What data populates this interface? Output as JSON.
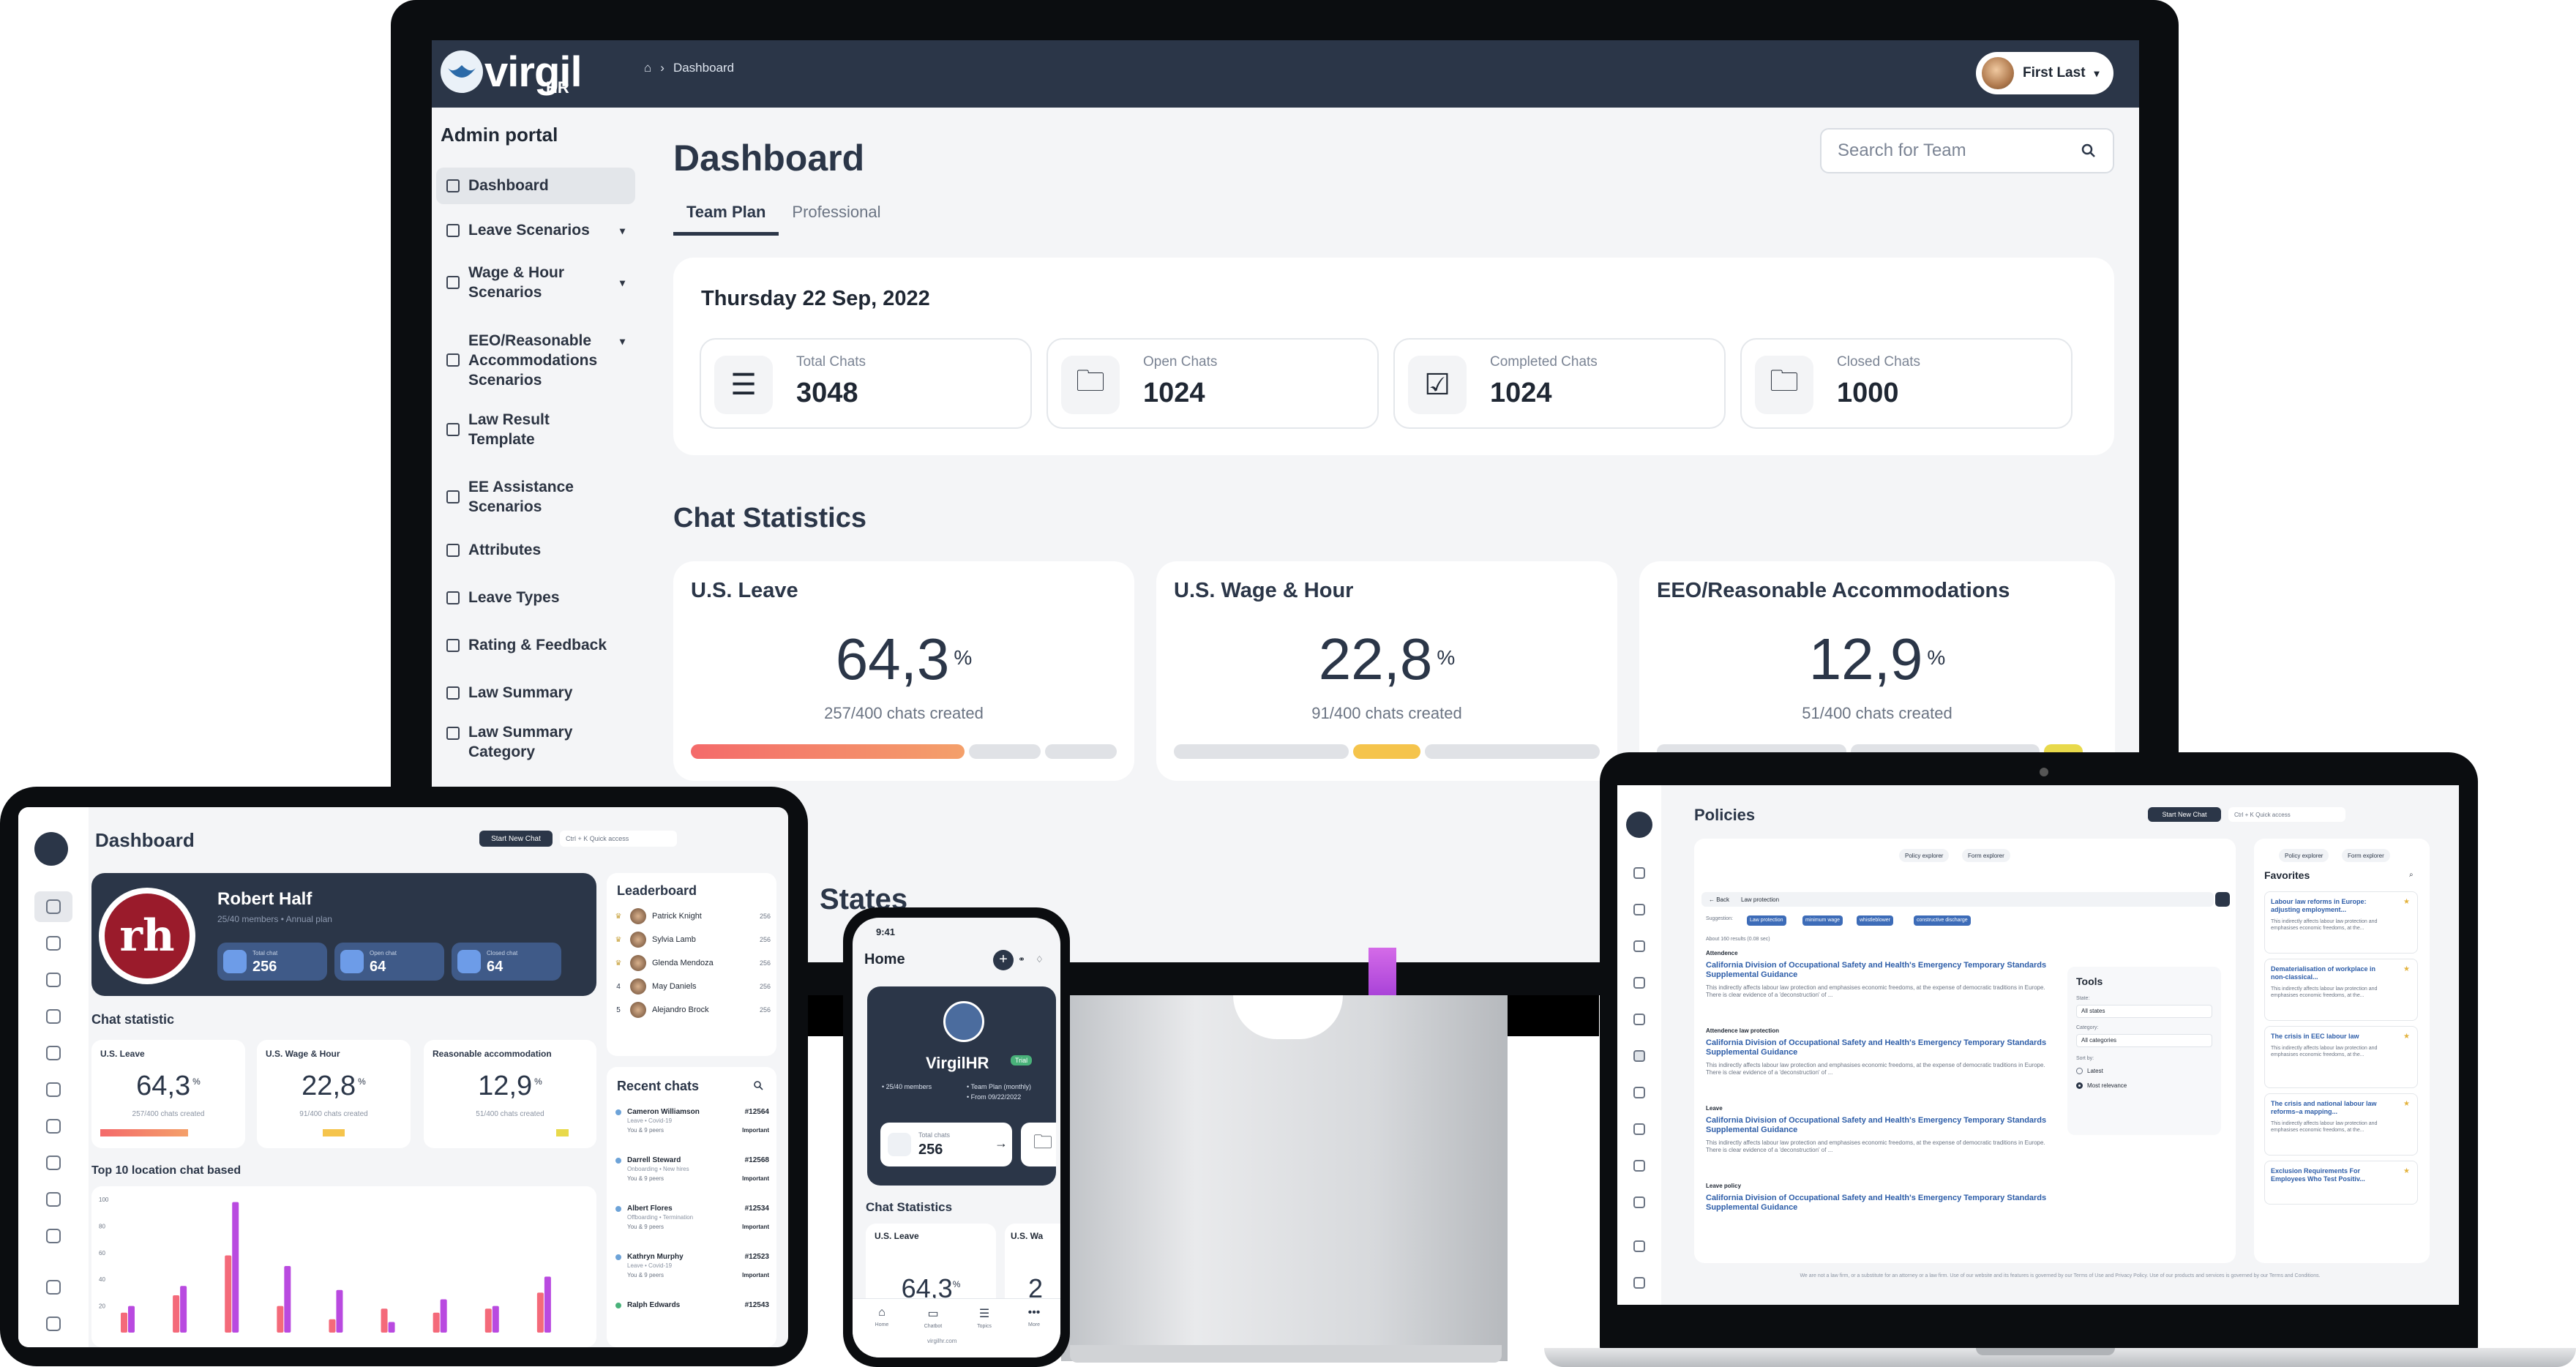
{
  "monitor": {
    "brand": "virgil",
    "brand_sub": "HR",
    "breadcrumb": "Dashboard",
    "user_name": "First Last",
    "sidebar_title": "Admin portal",
    "sidebar": [
      {
        "label": "Dashboard",
        "icon": "home-icon"
      },
      {
        "label": "Leave Scenarios",
        "icon": "document-icon",
        "chevron": "▾"
      },
      {
        "label": "Wage & Hour Scenarios",
        "icon": "document-icon",
        "chevron": "▾"
      },
      {
        "label": "EEO/Reasonable Accommodations Scenarios",
        "icon": "home-icon",
        "chevron": "▾"
      },
      {
        "label": "Law Result Template",
        "icon": "book-icon"
      },
      {
        "label": "EE Assistance Scenarios",
        "icon": "document-icon"
      },
      {
        "label": "Attributes",
        "icon": "list-icon"
      },
      {
        "label": "Leave Types",
        "icon": "card-icon"
      },
      {
        "label": "Rating & Feedback",
        "icon": "chat-icon"
      },
      {
        "label": "Law Summary",
        "icon": "folder-icon"
      },
      {
        "label": "Law Summary Category",
        "icon": "folder-icon"
      }
    ],
    "title": "Dashboard",
    "search_placeholder": "Search for Team",
    "tabs": [
      "Team Plan",
      "Professional"
    ],
    "date": "Thursday 22 Sep, 2022",
    "stats": [
      {
        "label": "Total Chats",
        "value": "3048",
        "icon": "checklist-icon"
      },
      {
        "label": "Open Chats",
        "value": "1024",
        "icon": "folder-open-icon"
      },
      {
        "label": "Completed Chats",
        "value": "1024",
        "icon": "checkbox-icon"
      },
      {
        "label": "Closed Chats",
        "value": "1000",
        "icon": "folder-icon"
      }
    ],
    "chat_stats_title": "Chat Statistics",
    "chat_cards": [
      {
        "title": "U.S. Leave",
        "value": "64,3",
        "unit": "%",
        "sub": "257/400 chats created",
        "level": 0.643,
        "color": "#f47a6a"
      },
      {
        "title": "U.S. Wage & Hour",
        "value": "22,8",
        "unit": "%",
        "sub": "91/400 chats created",
        "level": 0.228,
        "color": "#f5c44c"
      },
      {
        "title": "EEO/Reasonable Accommodations",
        "value": "12,9",
        "unit": "%",
        "sub": "51/400 chats created",
        "level": 0.129,
        "color": "#e8d94b"
      }
    ],
    "states_title": "States"
  },
  "tablet": {
    "title": "Dashboard",
    "new_chat": "Start New Chat",
    "quick": "Ctrl + K Quick access",
    "hero": {
      "logo_text": "rh",
      "name": "Robert Half",
      "sub": "25/40 members • Annual plan",
      "chips": [
        {
          "label": "Total chat",
          "value": "256"
        },
        {
          "label": "Open chat",
          "value": "64"
        },
        {
          "label": "Closed chat",
          "value": "64"
        }
      ]
    },
    "chat_statistic": "Chat statistic",
    "cards": [
      {
        "title": "U.S. Leave",
        "value": "64,3",
        "unit": "%",
        "sub": "257/400 chats created"
      },
      {
        "title": "U.S. Wage & Hour",
        "value": "22,8",
        "unit": "%",
        "sub": "91/400 chats created"
      },
      {
        "title": "Reasonable accommodation",
        "value": "12,9",
        "unit": "%",
        "sub": "51/400 chats created"
      }
    ],
    "top10_title": "Top 10 location chat based",
    "leaderboard_title": "Leaderboard",
    "leaderboard": [
      {
        "rank": "♛",
        "name": "Patrick Knight",
        "score": "256"
      },
      {
        "rank": "♛",
        "name": "Sylvia Lamb",
        "score": "256"
      },
      {
        "rank": "♛",
        "name": "Glenda Mendoza",
        "score": "256"
      },
      {
        "rank": "4",
        "name": "May Daniels",
        "score": "256"
      },
      {
        "rank": "5",
        "name": "Alejandro Brock",
        "score": "256"
      }
    ],
    "recent_title": "Recent chats",
    "recent": [
      {
        "name": "Cameron Williamson",
        "id": "#12564",
        "sub": "Leave • Covid-19",
        "meta": "You & 9 peers",
        "tag": "Important"
      },
      {
        "name": "Darrell Steward",
        "id": "#12568",
        "sub": "Onboarding • New hires",
        "meta": "You & 9 peers",
        "tag": "Important"
      },
      {
        "name": "Albert Flores",
        "id": "#12534",
        "sub": "Offboarding • Termination",
        "meta": "You & 9 peers",
        "tag": "Important"
      },
      {
        "name": "Kathryn Murphy",
        "id": "#12523",
        "sub": "Leave • Covid-19",
        "meta": "You & 9 peers",
        "tag": "Important"
      },
      {
        "name": "Ralph Edwards",
        "id": "#12543",
        "sub": "",
        "meta": "",
        "tag": ""
      }
    ]
  },
  "chart_data": {
    "type": "bar",
    "title": "Top 10 location chat based",
    "ylim": [
      0,
      100
    ],
    "yticks": [
      "100",
      "80",
      "60",
      "40",
      "20"
    ],
    "series": [
      {
        "color": "#f46a7a",
        "values": [
          15,
          28,
          58,
          20,
          10,
          18,
          15,
          18,
          30
        ]
      },
      {
        "color": "#b94ae0",
        "values": [
          20,
          35,
          98,
          50,
          32,
          8,
          25,
          20,
          42
        ]
      }
    ]
  },
  "phone": {
    "time": "9:41",
    "home": "Home",
    "hero_title": "VirgilHR",
    "trial": "Trial",
    "l1": "• 25/40 members",
    "l2": "• Team Plan (monthly)",
    "l3": "• From 09/22/2022",
    "total_label": "Total chats",
    "total_value": "256",
    "chat_stats": "Chat Statistics",
    "card1_title": "U.S. Leave",
    "card1_value": "64,3",
    "card1_unit": "%",
    "card2_title": "U.S. Wa",
    "card2_value": "2",
    "tabs": [
      "Home",
      "Chatbot",
      "Topics",
      "More"
    ],
    "url": "virgilhr.com"
  },
  "laptop": {
    "title": "Policies",
    "new_chat": "Start New Chat",
    "quick": "Ctrl + K Quick access",
    "pills": [
      "Policy explorer",
      "Form explorer"
    ],
    "back": "← Back",
    "query": "Law protection",
    "suggestion_label": "Suggestion:",
    "tags": [
      "Law protection",
      "minimum wage",
      "whistleblower",
      "constructive discharge"
    ],
    "results_count": "About 160 results (0.08 sec)",
    "results": [
      {
        "cat": "Attendence",
        "title": "California Division of Occupational Safety and Health's Emergency Temporary Standards Supplemental Guidance",
        "desc": "This indirectly affects labour law protection and emphasises economic freedoms, at the expense of democratic traditions in Europe. There is clear evidence of a 'deconstruction' of ..."
      },
      {
        "cat": "Attendence law protection",
        "title": "California Division of Occupational Safety and Health's Emergency Temporary Standards Supplemental Guidance",
        "desc": "This indirectly affects labour law protection and emphasises economic freedoms, at the expense of democratic traditions in Europe. There is clear evidence of a 'deconstruction' of ..."
      },
      {
        "cat": "Leave",
        "title": "California Division of Occupational Safety and Health's Emergency Temporary Standards Supplemental Guidance",
        "desc": "This indirectly affects labour law protection and emphasises economic freedoms, at the expense of democratic traditions in Europe. There is clear evidence of a 'deconstruction' of ..."
      },
      {
        "cat": "Leave policy",
        "title": "California Division of Occupational Safety and Health's Emergency Temporary Standards Supplemental Guidance",
        "desc": ""
      }
    ],
    "tools": {
      "title": "Tools",
      "state_label": "State:",
      "state_value": "All states",
      "category_label": "Category:",
      "category_value": "All categories",
      "sort_label": "Sort by:",
      "sort_opts": [
        "Latest",
        "Most relevance"
      ]
    },
    "favs_title": "Favorites",
    "favs": [
      {
        "title": "Labour law reforms in Europe: adjusting employment...",
        "desc": "This indirectly affects labour law protection and emphasises economic freedoms, at the..."
      },
      {
        "title": "Dematerialisation of workplace in non-classical...",
        "desc": "This indirectly affects labour law protection and emphasises economic freedoms, at the..."
      },
      {
        "title": "The crisis in EEC labour law",
        "desc": "This indirectly affects labour law protection and emphasises economic freedoms, at the..."
      },
      {
        "title": "The crisis and national labour law reforms–a mapping...",
        "desc": "This indirectly affects labour law protection and emphasises economic freedoms, at the..."
      },
      {
        "title": "Exclusion Requirements For Employees Who Test Positiv...",
        "desc": ""
      }
    ],
    "footer": "We are not a law firm, or a substitute for an attorney or a law firm. Use of our website and its features is governed by our Terms of Use and Privacy Policy. Use of our products and services is governed by our Terms and Conditions."
  }
}
